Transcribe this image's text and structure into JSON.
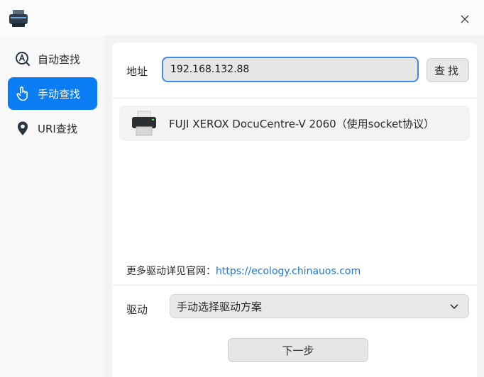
{
  "titlebar": {
    "app_icon": "printer-icon",
    "close_icon": "close-icon"
  },
  "sidebar": {
    "items": [
      {
        "label": "自动查找",
        "icon": "auto-search-icon",
        "active": false
      },
      {
        "label": "手动查找",
        "icon": "hand-pointer-icon",
        "active": true
      },
      {
        "label": "URI查找",
        "icon": "location-pin-icon",
        "active": false
      }
    ]
  },
  "search": {
    "address_label": "地址",
    "address_value": "192.168.132.88",
    "find_label": "查找"
  },
  "results": [
    {
      "name": "FUJI XEROX DocuCentre-V 2060（使用socket协议）",
      "icon": "printer-icon"
    }
  ],
  "more": {
    "prefix": "更多驱动详见官网：",
    "link": "https://ecology.chinauos.com"
  },
  "driver": {
    "label": "驱动",
    "selected": "手动选择驱动方案"
  },
  "next_label": "下一步",
  "colors": {
    "accent": "#0a7df5",
    "link": "#1f77d4",
    "focus_border": "#3d8ae8"
  }
}
